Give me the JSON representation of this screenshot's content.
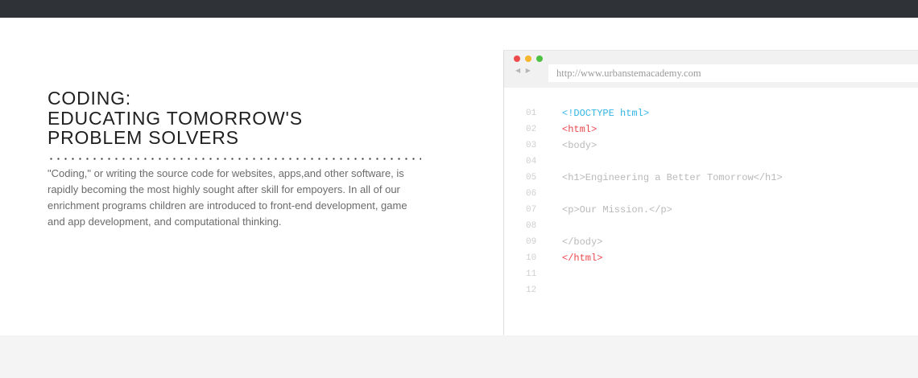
{
  "headline": {
    "lines": [
      "CODING:",
      "EDUCATING TOMORROW'S",
      "PROBLEM SOLVERS"
    ]
  },
  "description": "\"Coding,\" or writing the source code for websites, apps,and other software, is rapidly becoming the most highly sought after skill for empoyers. In all of our enrichment programs children are introduced to front-end development, game and app development, and computational thinking.",
  "browser": {
    "url": "http://www.urbanstemacademy.com",
    "nav_arrows": "◀ ▶"
  },
  "code_lines": [
    {
      "no": "01",
      "text": "<!DOCTYPE html>"
    },
    {
      "no": "02",
      "text": "<html>"
    },
    {
      "no": "03",
      "text": "<body>"
    },
    {
      "no": "04",
      "text": ""
    },
    {
      "no": "05",
      "text": "<h1>Engineering a Better Tomorrow</h1>"
    },
    {
      "no": "06",
      "text": ""
    },
    {
      "no": "07",
      "text": "<p>Our Mission.</p>"
    },
    {
      "no": "08",
      "text": ""
    },
    {
      "no": "09",
      "text": "</body>"
    },
    {
      "no": "10",
      "text": "</html>"
    },
    {
      "no": "11",
      "text": ""
    },
    {
      "no": "12",
      "text": ""
    }
  ],
  "colors": {
    "doctype": "#35b5e5",
    "html_tag": "#e8484e",
    "plain_tag": "#b9b9b9",
    "topbar": "#2f3337"
  }
}
